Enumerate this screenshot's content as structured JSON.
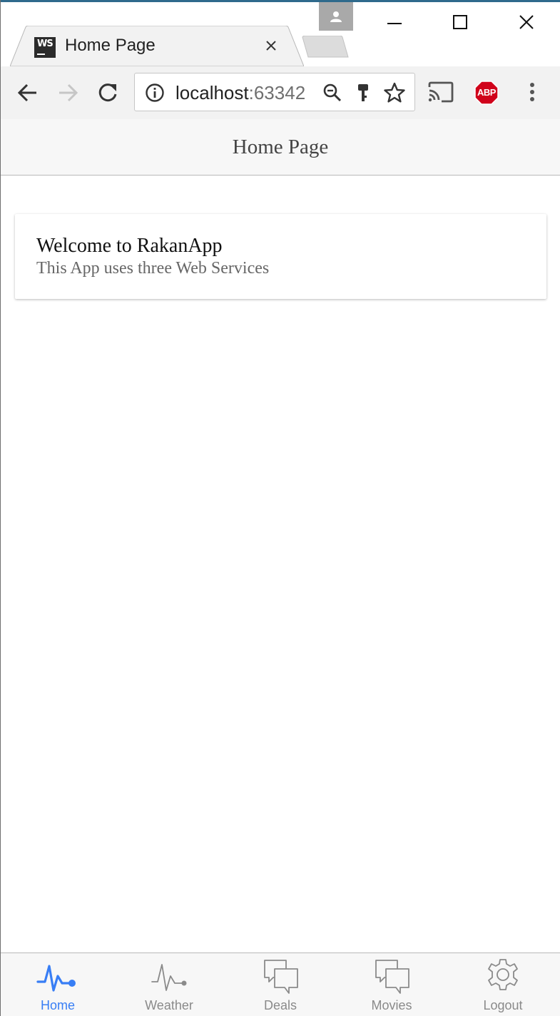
{
  "browser": {
    "tab_title": "Home Page",
    "favicon_text": "WS",
    "url_host": "localhost",
    "url_port": ":63342",
    "abp_label": "ABP"
  },
  "app": {
    "header_title": "Home Page",
    "card": {
      "title": "Welcome to RakanApp",
      "subtitle": "This App uses three Web Services"
    },
    "tabs": [
      {
        "label": "Home",
        "icon": "pulse-icon",
        "active": true
      },
      {
        "label": "Weather",
        "icon": "pulse-icon",
        "active": false
      },
      {
        "label": "Deals",
        "icon": "chatboxes-icon",
        "active": false
      },
      {
        "label": "Movies",
        "icon": "chatboxes-icon",
        "active": false
      },
      {
        "label": "Logout",
        "icon": "settings-icon",
        "active": false
      }
    ]
  },
  "colors": {
    "accent": "#387ef5",
    "inactive": "#8a8a8a",
    "abp_red": "#d0021b"
  }
}
